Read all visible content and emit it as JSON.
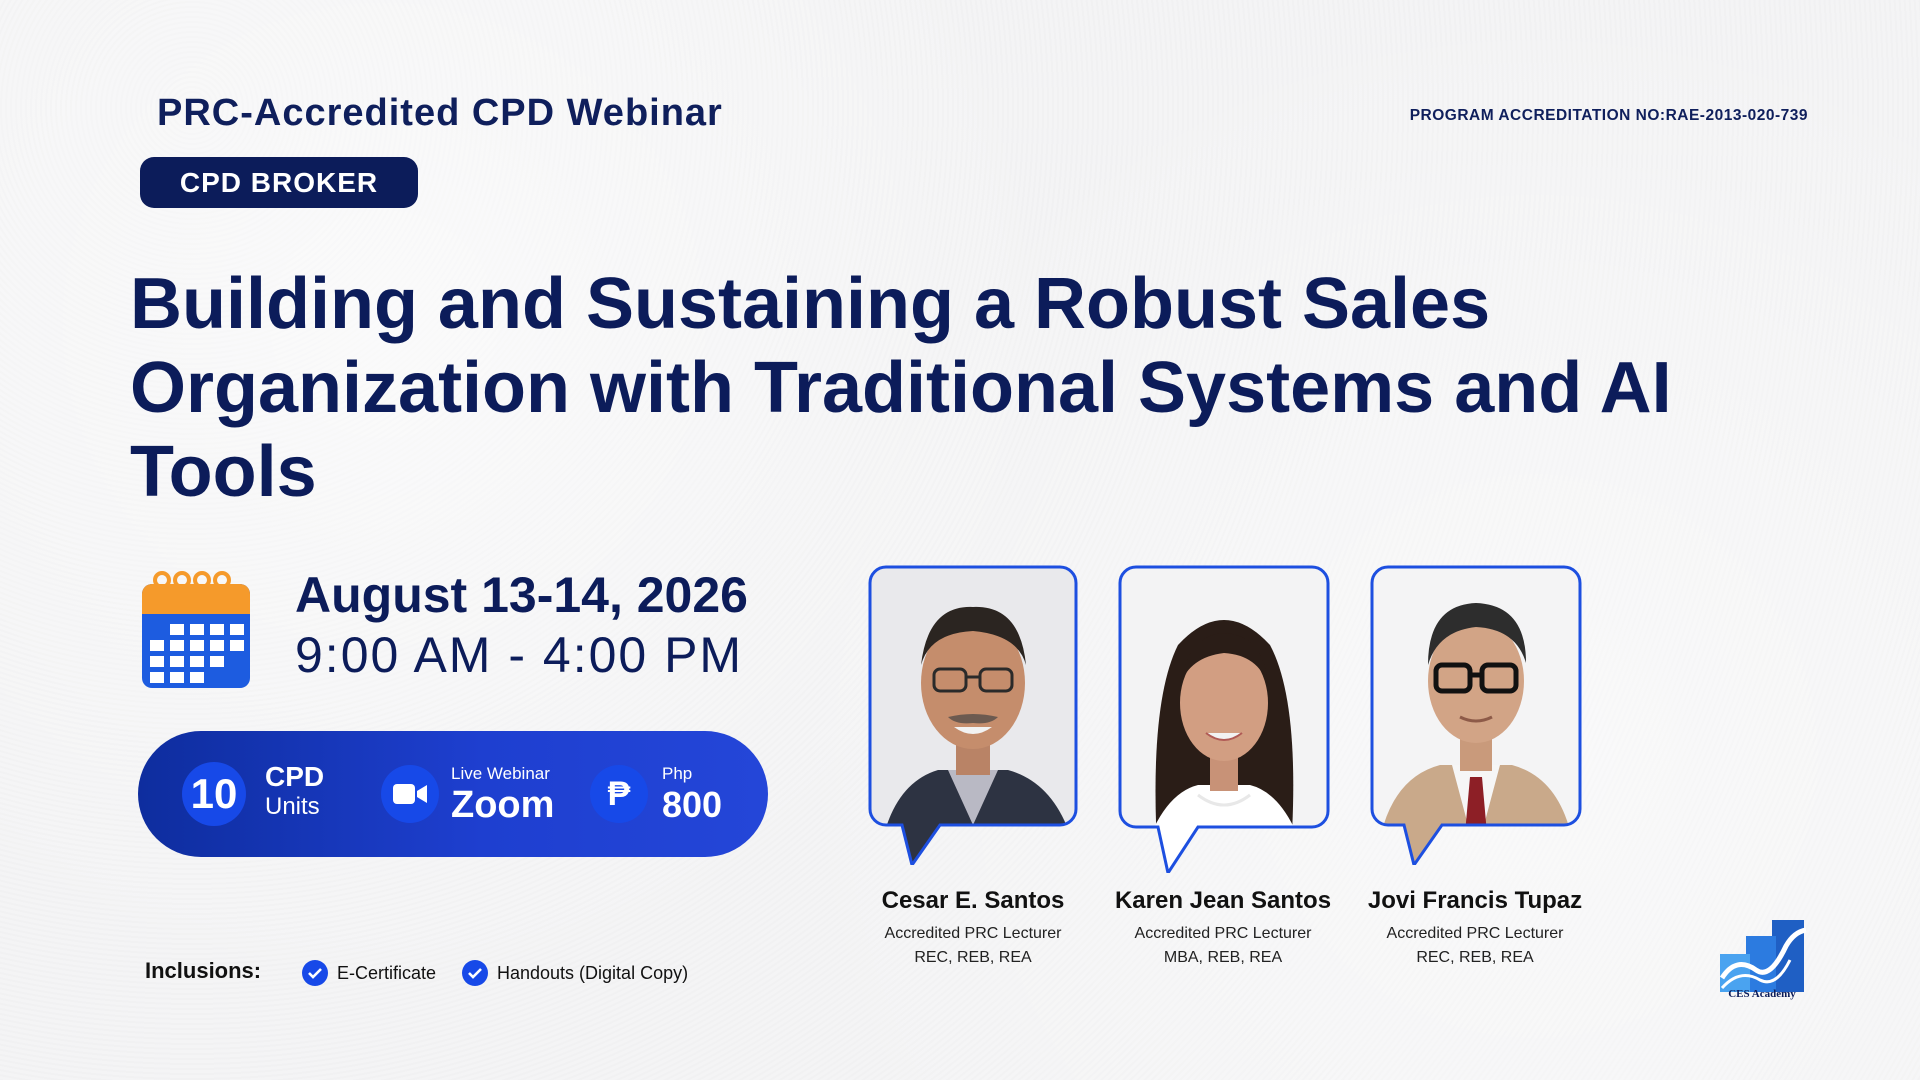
{
  "header": {
    "title": "PRC-Accredited CPD Webinar",
    "accreditation": "PROGRAM ACCREDITATION NO:RAE-2013-020-739",
    "badge": "CPD BROKER"
  },
  "main": {
    "title_lines": [
      "Building and Sustaining a Robust Sales",
      "Organization with Traditional Systems and AI",
      "Tools"
    ],
    "date": "August 13-14, 2026",
    "time": "9:00 AM - 4:00 PM"
  },
  "info": {
    "units_value": "10",
    "units_title": "CPD",
    "units_sub": "Units",
    "webinar_label": "Live Webinar",
    "platform": "Zoom",
    "currency_symbol": "₱",
    "currency_label": "Php",
    "price": "800"
  },
  "speakers": [
    {
      "name": "Cesar E. Santos",
      "role": "Accredited PRC Lecturer",
      "creds": "REC, REB, REA"
    },
    {
      "name": "Karen Jean Santos",
      "role": "Accredited PRC Lecturer",
      "creds": "MBA, REB, REA"
    },
    {
      "name": "Jovi Francis Tupaz",
      "role": "Accredited PRC Lecturer",
      "creds": "REC, REB, REA"
    }
  ],
  "inclusions": {
    "label": "Inclusions:",
    "items": [
      "E-Certificate",
      "Handouts (Digital Copy)"
    ]
  },
  "logo": {
    "text": "CES Academy",
    "icon": "ces-academy-logo"
  },
  "colors": {
    "navy": "#0c1c5a",
    "accent_blue": "#1749e8",
    "calendar_orange": "#f59a2b",
    "calendar_blue": "#1d5ce0"
  }
}
